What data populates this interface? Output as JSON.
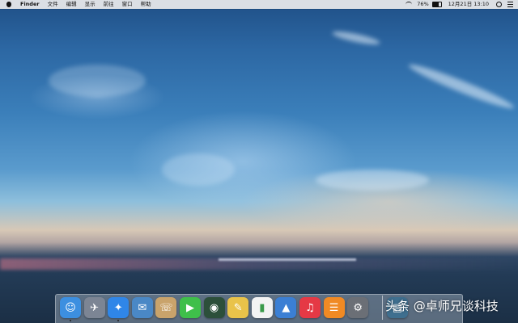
{
  "menubar": {
    "app_name": "Finder",
    "menus": [
      "文件",
      "编辑",
      "显示",
      "前往",
      "窗口",
      "帮助"
    ],
    "battery_percent": "76%",
    "battery_level": 0.76,
    "datetime": "12月21日  13:10"
  },
  "dock": {
    "apps": [
      {
        "name": "finder-icon",
        "glyph": "☺",
        "color": "#3c8fe0",
        "running": true
      },
      {
        "name": "launchpad-icon",
        "glyph": "✈",
        "color": "#7c8594",
        "running": false
      },
      {
        "name": "safari-icon",
        "glyph": "✦",
        "color": "#2f86e8",
        "running": true
      },
      {
        "name": "mail-icon",
        "glyph": "✉",
        "color": "#4a88c6",
        "running": false
      },
      {
        "name": "contacts-icon",
        "glyph": "☏",
        "color": "#c9a36b",
        "running": false
      },
      {
        "name": "facetime-icon",
        "glyph": "▶",
        "color": "#3fbf4a",
        "running": false
      },
      {
        "name": "photo-booth-icon",
        "glyph": "◉",
        "color": "#2c4f3a",
        "running": false
      },
      {
        "name": "notes-icon",
        "glyph": "✎",
        "color": "#e9c34a",
        "running": false
      },
      {
        "name": "numbers-icon",
        "glyph": "▮",
        "color": "#f3f3f3",
        "running": false
      },
      {
        "name": "keynote-icon",
        "glyph": "▲",
        "color": "#3b7fd4",
        "running": false
      },
      {
        "name": "itunes-icon",
        "glyph": "♫",
        "color": "#e53945",
        "running": false
      },
      {
        "name": "ibooks-icon",
        "glyph": "☰",
        "color": "#f08a24",
        "running": false
      },
      {
        "name": "system-preferences-icon",
        "glyph": "⚙",
        "color": "#6b6f76",
        "running": false
      },
      {
        "name": "downloads-stack-icon",
        "glyph": "▤",
        "color": "#3f6f8f",
        "running": false
      }
    ]
  },
  "watermark": {
    "text": "头条 @卓师兄谈科技"
  },
  "colors": {
    "menubar_bg": "#ececec",
    "dock_bg": "#d2dce8"
  }
}
